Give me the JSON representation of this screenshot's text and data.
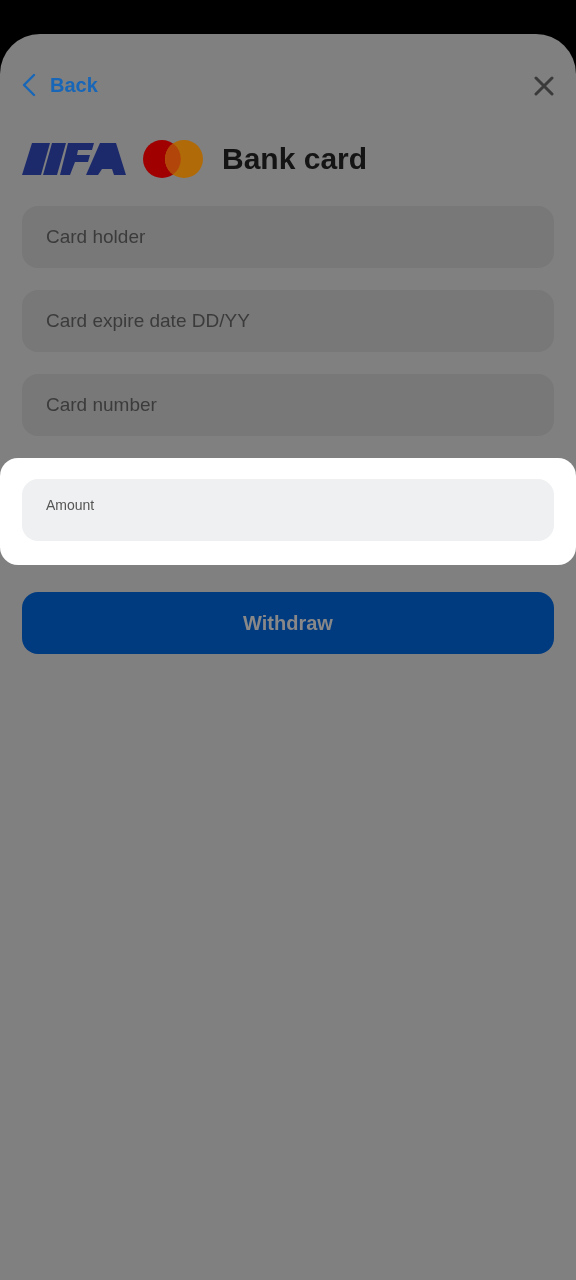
{
  "header": {
    "back": "Back"
  },
  "title": "Bank card",
  "fields": [
    {
      "placeholder": "Card holder",
      "highlighted": false
    },
    {
      "placeholder": "Card expire date DD/YY",
      "highlighted": false
    },
    {
      "placeholder": "Card number",
      "highlighted": false
    },
    {
      "label": "Amount",
      "highlighted": true
    }
  ],
  "button": {
    "label": "Withdraw"
  }
}
